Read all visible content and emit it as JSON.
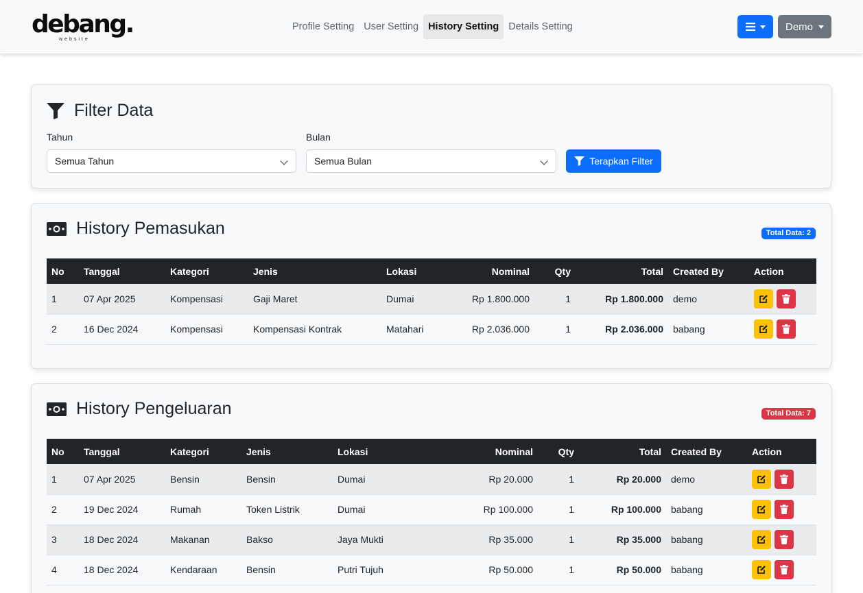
{
  "brand": {
    "name": "debang.",
    "tagline": "website"
  },
  "nav": {
    "links": [
      {
        "label": "Profile Setting"
      },
      {
        "label": "User Setting"
      },
      {
        "label": "History Setting"
      },
      {
        "label": "Details Setting"
      }
    ],
    "active": "History Setting",
    "user_label": "Demo"
  },
  "filter": {
    "title": "Filter Data",
    "year_label": "Tahun",
    "year_value": "Semua Tahun",
    "month_label": "Bulan",
    "month_value": "Semua Bulan",
    "apply_label": "Terapkan Filter"
  },
  "income": {
    "title": "History Pemasukan",
    "badge": "Total Data: 2",
    "headers": [
      "No",
      "Tanggal",
      "Kategori",
      "Jenis",
      "Lokasi",
      "Nominal",
      "Qty",
      "Total",
      "Created By",
      "Action"
    ],
    "rows": [
      {
        "no": "1",
        "tanggal": "07 Apr 2025",
        "kategori": "Kompensasi",
        "jenis": "Gaji Maret",
        "lokasi": "Dumai",
        "nominal": "Rp 1.800.000",
        "qty": "1",
        "total": "Rp 1.800.000",
        "created_by": "demo"
      },
      {
        "no": "2",
        "tanggal": "16 Dec 2024",
        "kategori": "Kompensasi",
        "jenis": "Kompensasi Kontrak",
        "lokasi": "Matahari",
        "nominal": "Rp 2.036.000",
        "qty": "1",
        "total": "Rp 2.036.000",
        "created_by": "babang"
      }
    ]
  },
  "expense": {
    "title": "History Pengeluaran",
    "badge": "Total Data: 7",
    "headers": [
      "No",
      "Tanggal",
      "Kategori",
      "Jenis",
      "Lokasi",
      "Nominal",
      "Qty",
      "Total",
      "Created By",
      "Action"
    ],
    "rows": [
      {
        "no": "1",
        "tanggal": "07 Apr 2025",
        "kategori": "Bensin",
        "jenis": "Bensin",
        "lokasi": "Dumai",
        "nominal": "Rp 20.000",
        "qty": "1",
        "total": "Rp 20.000",
        "created_by": "demo"
      },
      {
        "no": "2",
        "tanggal": "19 Dec 2024",
        "kategori": "Rumah",
        "jenis": "Token Listrik",
        "lokasi": "Dumai",
        "nominal": "Rp 100.000",
        "qty": "1",
        "total": "Rp 100.000",
        "created_by": "babang"
      },
      {
        "no": "3",
        "tanggal": "18 Dec 2024",
        "kategori": "Makanan",
        "jenis": "Bakso",
        "lokasi": "Jaya Mukti",
        "nominal": "Rp 35.000",
        "qty": "1",
        "total": "Rp 35.000",
        "created_by": "babang"
      },
      {
        "no": "4",
        "tanggal": "18 Dec 2024",
        "kategori": "Kendaraan",
        "jenis": "Bensin",
        "lokasi": "Putri Tujuh",
        "nominal": "Rp 50.000",
        "qty": "1",
        "total": "Rp 50.000",
        "created_by": "babang"
      }
    ]
  },
  "colors": {
    "primary": "#0d6efd",
    "danger": "#dc3545",
    "warning": "#ffc107",
    "secondary": "#6c757d",
    "dark": "#212529"
  },
  "icons": {
    "filter": "filter-icon",
    "money": "money-bill-icon",
    "edit": "edit-icon",
    "delete": "trash-icon",
    "menu": "hamburger-icon"
  }
}
